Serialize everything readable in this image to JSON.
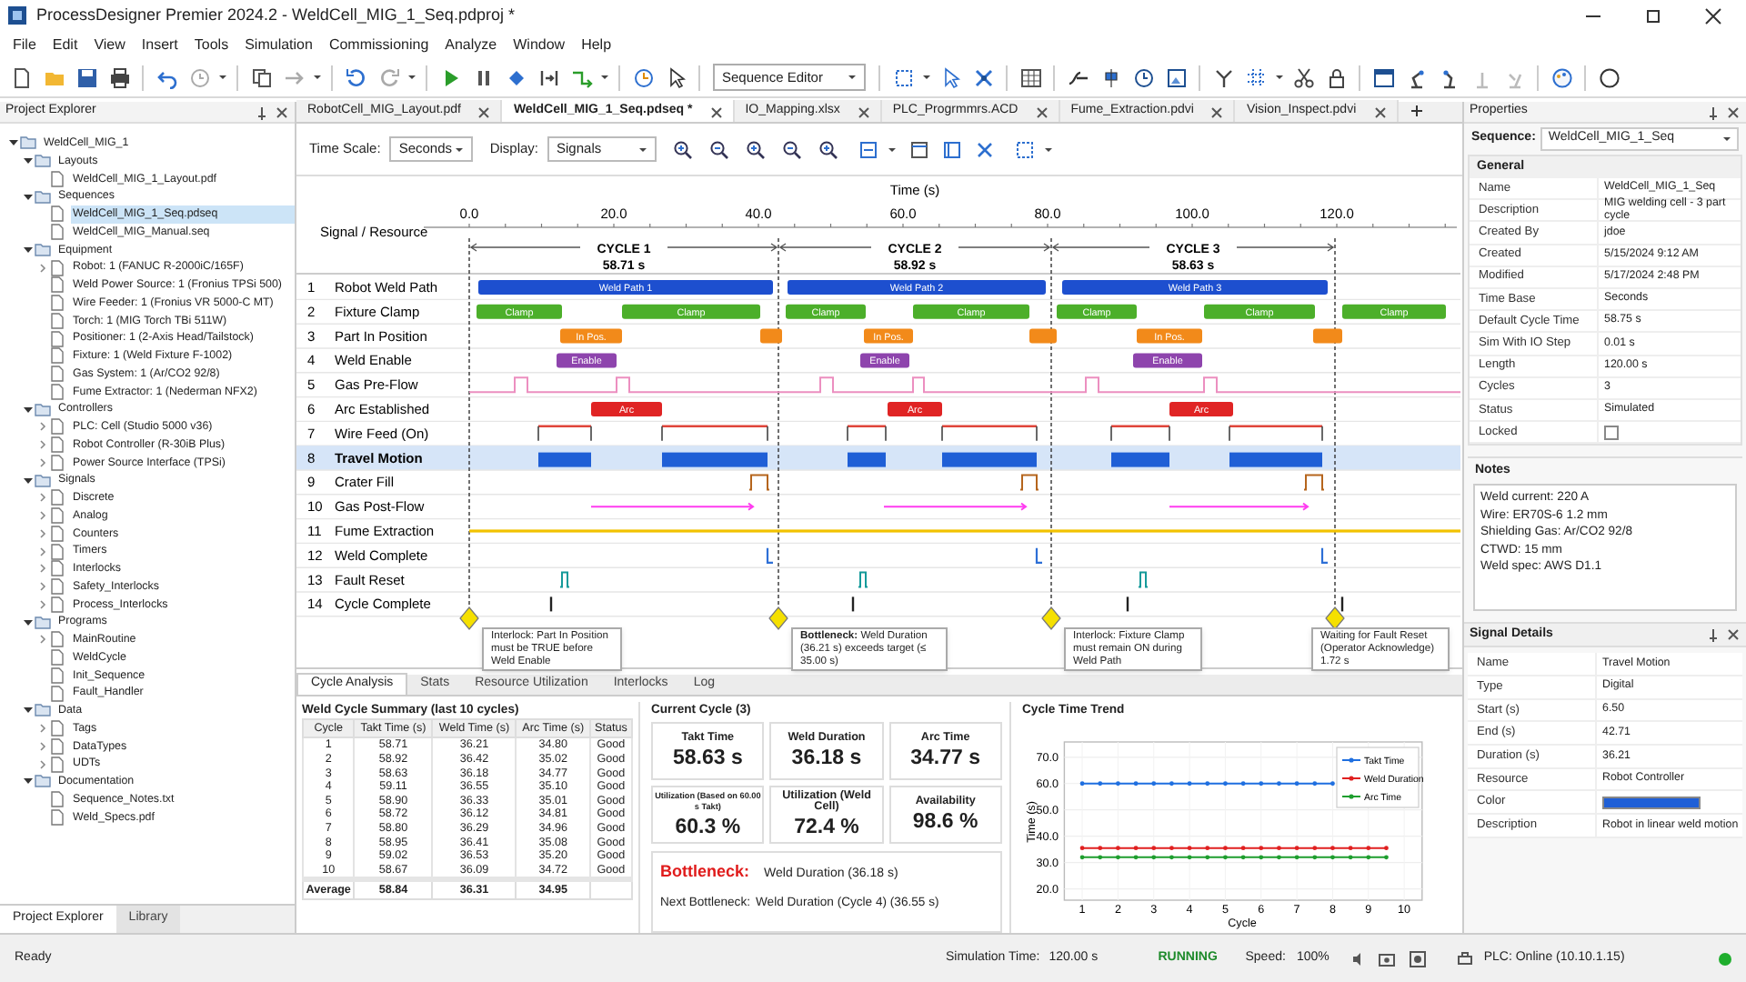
{
  "window": {
    "title": "ProcessDesigner Premier 2024.2 - WeldCell_MIG_1_Seq.pdproj *"
  },
  "menu": [
    "File",
    "Edit",
    "View",
    "Insert",
    "Tools",
    "Simulation",
    "Commissioning",
    "Analyze",
    "Window",
    "Help"
  ],
  "toolbar": {
    "view_select": "Sequence Editor"
  },
  "project_explorer": {
    "title": "Project Explorer",
    "tree": [
      {
        "label": "WeldCell_MIG_1",
        "expanded": true,
        "selected": false,
        "children": [
          {
            "label": "Layouts",
            "expanded": true,
            "selected": false,
            "children": [
              {
                "label": "WeldCell_MIG_1_Layout.pdf",
                "selected": false
              }
            ]
          },
          {
            "label": "Sequences",
            "expanded": true,
            "selected": false,
            "children": [
              {
                "label": "WeldCell_MIG_1_Seq.pdseq",
                "selected": true
              },
              {
                "label": "WeldCell_MIG_Manual.seq",
                "selected": false
              }
            ]
          },
          {
            "label": "Equipment",
            "expanded": true,
            "selected": false,
            "children": [
              {
                "label": "Robot: 1 (FANUC R-2000iC/165F)",
                "expanded": false,
                "selected": false
              },
              {
                "label": "Weld Power Source: 1 (Fronius TPSi 500)",
                "selected": false
              },
              {
                "label": "Wire Feeder: 1 (Fronius VR 5000-C MT)",
                "selected": false
              },
              {
                "label": "Torch: 1 (MIG Torch TBi 511W)",
                "selected": false
              },
              {
                "label": "Positioner: 1 (2-Axis Head/Tailstock)",
                "selected": false
              },
              {
                "label": "Fixture: 1 (Weld Fixture F-1002)",
                "selected": false
              },
              {
                "label": "Gas System: 1 (Ar/CO2 92/8)",
                "selected": false
              },
              {
                "label": "Fume Extractor: 1 (Nederman NFX2)",
                "selected": false
              }
            ]
          },
          {
            "label": "Controllers",
            "expanded": true,
            "selected": false,
            "children": [
              {
                "label": "PLC: Cell (Studio 5000 v36)",
                "expanded": false,
                "selected": false
              },
              {
                "label": "Robot Controller (R-30iB Plus)",
                "expanded": false,
                "selected": false
              },
              {
                "label": "Power Source Interface (TPSi)",
                "expanded": false,
                "selected": false
              }
            ]
          },
          {
            "label": "Signals",
            "expanded": true,
            "selected": false,
            "children": [
              {
                "label": "Discrete",
                "expanded": false,
                "selected": false
              },
              {
                "label": "Analog",
                "expanded": false,
                "selected": false
              },
              {
                "label": "Counters",
                "expanded": false,
                "selected": false
              },
              {
                "label": "Timers",
                "expanded": false,
                "selected": false
              },
              {
                "label": "Interlocks",
                "expanded": false,
                "selected": false
              },
              {
                "label": "Safety_Interlocks",
                "expanded": false,
                "selected": false
              },
              {
                "label": "Process_Interlocks",
                "expanded": false,
                "selected": false
              }
            ]
          },
          {
            "label": "Programs",
            "expanded": true,
            "selected": false,
            "children": [
              {
                "label": "MainRoutine",
                "expanded": false,
                "selected": false
              },
              {
                "label": "WeldCycle",
                "selected": false
              },
              {
                "label": "Init_Sequence",
                "selected": false
              },
              {
                "label": "Fault_Handler",
                "selected": false
              }
            ]
          },
          {
            "label": "Data",
            "expanded": true,
            "selected": false,
            "children": [
              {
                "label": "Tags",
                "expanded": false,
                "selected": false
              },
              {
                "label": "DataTypes",
                "expanded": false,
                "selected": false
              },
              {
                "label": "UDTs",
                "expanded": false,
                "selected": false
              }
            ]
          },
          {
            "label": "Documentation",
            "expanded": true,
            "selected": false,
            "children": [
              {
                "label": "Sequence_Notes.txt",
                "selected": false
              },
              {
                "label": "Weld_Specs.pdf",
                "selected": false
              }
            ]
          }
        ]
      }
    ],
    "tabs": [
      {
        "label": "Project Explorer",
        "selected": true
      },
      {
        "label": "Library",
        "selected": false
      }
    ]
  },
  "document_tabs": [
    {
      "label": "RobotCell_MIG_Layout.pdf",
      "selected": false
    },
    {
      "label": "WeldCell_MIG_1_Seq.pdseq *",
      "selected": true
    },
    {
      "label": "IO_Mapping.xlsx",
      "selected": false
    },
    {
      "label": "PLC_Progrmmrs.ACD",
      "selected": false
    },
    {
      "label": "Fume_Extraction.pdvi",
      "selected": false
    },
    {
      "label": "Vision_Inspect.pdvi",
      "selected": false
    }
  ],
  "editor": {
    "time_scale_label": "Time Scale:",
    "time_scale": "Seconds",
    "display_label": "Display:",
    "display": "Signals"
  },
  "timing_diagram": {
    "axis_title": "Time (s)",
    "ticks": [
      "0.0",
      "20.0",
      "40.0",
      "60.0",
      "80.0",
      "100.0",
      "120.0"
    ],
    "header": "Signal / Resource",
    "cycles": [
      {
        "label": "CYCLE 1",
        "duration": "58.71 s"
      },
      {
        "label": "CYCLE 2",
        "duration": "58.92 s"
      },
      {
        "label": "CYCLE 3",
        "duration": "58.63 s"
      }
    ],
    "signals": [
      {
        "number": "1",
        "name": "Robot Weld Path",
        "selected": false,
        "bar_labels": [
          "Weld Path 1",
          "Weld Path 2",
          "Weld Path 3"
        ]
      },
      {
        "number": "2",
        "name": "Fixture Clamp",
        "selected": false,
        "bar_labels": [
          "Clamp",
          "Clamp",
          "Clamp",
          "Clamp",
          "Clamp",
          "Clamp",
          "Clamp"
        ]
      },
      {
        "number": "3",
        "name": "Part In Position",
        "selected": false,
        "bar_labels": [
          "In Pos.",
          "In Pos.",
          "In Pos."
        ]
      },
      {
        "number": "4",
        "name": "Weld Enable",
        "selected": false,
        "bar_labels": [
          "Enable",
          "Enable",
          "Enable"
        ]
      },
      {
        "number": "5",
        "name": "Gas Pre-Flow",
        "selected": false
      },
      {
        "number": "6",
        "name": "Arc Established",
        "selected": false,
        "bar_labels": [
          "Arc",
          "Arc",
          "Arc"
        ]
      },
      {
        "number": "7",
        "name": "Wire Feed (On)",
        "selected": false
      },
      {
        "number": "8",
        "name": "Travel Motion",
        "selected": true
      },
      {
        "number": "9",
        "name": "Crater Fill",
        "selected": false
      },
      {
        "number": "10",
        "name": "Gas Post-Flow",
        "selected": false
      },
      {
        "number": "11",
        "name": "Fume Extraction",
        "selected": false
      },
      {
        "number": "12",
        "name": "Weld Complete",
        "selected": false
      },
      {
        "number": "13",
        "name": "Fault Reset",
        "selected": false
      },
      {
        "number": "14",
        "name": "Cycle Complete",
        "selected": false
      }
    ],
    "callouts": [
      "Interlock: Part In Position must be TRUE before Weld Enable",
      "**Bottleneck:** Weld Duration (36.21 s) exceeds target (≤ 35.00 s)",
      "Interlock: Fixture Clamp must remain ON during Weld Path",
      "Waiting for Fault Reset (Operator Acknowledge) 1.72 s"
    ]
  },
  "analysis": {
    "tabs": [
      {
        "label": "Cycle Analysis",
        "selected": true
      },
      {
        "label": "Stats",
        "selected": false
      },
      {
        "label": "Resource Utilization",
        "selected": false
      },
      {
        "label": "Interlocks",
        "selected": false
      },
      {
        "label": "Log",
        "selected": false
      }
    ],
    "summary": {
      "title": "Weld Cycle Summary (last 10 cycles)",
      "columns": [
        "Cycle",
        "Takt Time (s)",
        "Weld Time (s)",
        "Arc Time (s)",
        "Status"
      ],
      "rows": [
        [
          "1",
          "58.71",
          "36.21",
          "34.80",
          "Good"
        ],
        [
          "2",
          "58.92",
          "36.42",
          "35.02",
          "Good"
        ],
        [
          "3",
          "58.63",
          "36.18",
          "34.77",
          "Good"
        ],
        [
          "4",
          "59.11",
          "36.55",
          "35.10",
          "Good"
        ],
        [
          "5",
          "58.90",
          "36.33",
          "35.01",
          "Good"
        ],
        [
          "6",
          "58.72",
          "36.12",
          "34.81",
          "Good"
        ],
        [
          "7",
          "58.80",
          "36.29",
          "34.96",
          "Good"
        ],
        [
          "8",
          "58.95",
          "36.41",
          "35.08",
          "Good"
        ],
        [
          "9",
          "59.02",
          "36.53",
          "35.20",
          "Good"
        ],
        [
          "10",
          "58.67",
          "36.09",
          "34.72",
          "Good"
        ]
      ],
      "average": {
        "label": "Average",
        "values": [
          "58.84",
          "36.31",
          "34.95"
        ]
      }
    },
    "current_cycle": {
      "title": "Current Cycle (3)",
      "cards": [
        {
          "label": "Takt Time",
          "value": "58.63 s"
        },
        {
          "label": "Weld Duration",
          "value": "36.18 s"
        },
        {
          "label": "Arc Time",
          "value": "34.77 s"
        },
        {
          "label": "Utilization (Based on 60.00 s Takt)",
          "value": "60.3 %"
        },
        {
          "label": "Utilization (Weld Cell)",
          "value": "72.4 %"
        },
        {
          "label": "Availability",
          "value": "98.6 %"
        }
      ],
      "bottleneck": {
        "label": "Bottleneck:",
        "value": "Weld Duration (36.18 s)"
      },
      "next_bottleneck": {
        "label": "Next Bottleneck:",
        "value": "Weld Duration (Cycle 4) (36.55 s)"
      }
    },
    "trend": {
      "chart_data": {
        "type": "line",
        "title": "Cycle Time Trend",
        "xlabel": "Cycle",
        "ylabel": "Time (s)",
        "x": [
          1,
          1.5,
          2,
          2.5,
          3,
          3.5,
          4,
          4.5,
          5,
          5.5,
          6,
          6.5,
          7,
          7.5,
          8,
          8.5,
          9,
          9.5
        ],
        "series": [
          {
            "name": "Takt Time",
            "color": "#1f6fe0",
            "values": [
              60,
              60,
              60,
              60,
              60,
              60,
              60,
              60,
              60,
              60,
              60,
              60,
              60,
              60,
              60,
              null,
              null,
              null
            ]
          },
          {
            "name": "Weld Duration",
            "color": "#e02020",
            "values": [
              35.5,
              35.5,
              35.5,
              35.5,
              35.5,
              35.5,
              35.5,
              35.5,
              35.5,
              35.5,
              35.5,
              35.5,
              35.5,
              35.5,
              35.5,
              35.5,
              35.5,
              35.5
            ]
          },
          {
            "name": "Arc Time",
            "color": "#1e9e2e",
            "values": [
              32,
              32,
              32,
              32,
              32,
              32,
              32,
              32,
              32,
              32,
              32,
              32,
              32,
              32,
              32,
              32,
              32,
              32
            ]
          }
        ],
        "grid": true,
        "legend": true,
        "xlim": [
          0.5,
          10.5
        ],
        "ylim": [
          15.7,
          75.8
        ],
        "xticks": [
          1,
          2,
          3,
          4,
          5,
          6,
          7,
          8,
          9,
          10
        ],
        "yticks": [
          {
            "value": 20,
            "label": "20.0"
          },
          {
            "value": 30,
            "label": "30.0"
          },
          {
            "value": 40,
            "label": "40.0"
          },
          {
            "value": 50,
            "label": "50.0"
          },
          {
            "value": 60,
            "label": "60.0"
          },
          {
            "value": 70,
            "label": "70.0"
          }
        ]
      }
    }
  },
  "properties": {
    "title": "Properties",
    "sequence_label": "Sequence:",
    "sequence": "WeldCell_MIG_1_Seq",
    "section": "General",
    "rows": [
      {
        "name": "Name",
        "kind": "text",
        "value": "WeldCell_MIG_1_Seq"
      },
      {
        "name": "Description",
        "kind": "text",
        "value": "MIG welding cell - 3 part cycle"
      },
      {
        "name": "Created By",
        "kind": "text",
        "value": "jdoe"
      },
      {
        "name": "Created",
        "kind": "text",
        "value": "5/15/2024 9:12 AM"
      },
      {
        "name": "Modified",
        "kind": "text",
        "value": "5/17/2024 2:48 PM"
      },
      {
        "name": "Time Base",
        "kind": "text",
        "value": "Seconds"
      },
      {
        "name": "Default Cycle Time",
        "kind": "text",
        "value": "58.75 s"
      },
      {
        "name": "Sim With IO Step",
        "kind": "text",
        "value": "0.01 s"
      },
      {
        "name": "Length",
        "kind": "text",
        "value": "120.00 s"
      },
      {
        "name": "Cycles",
        "kind": "text",
        "value": "3"
      },
      {
        "name": "Status",
        "kind": "text",
        "value": "Simulated"
      },
      {
        "name": "Locked",
        "kind": "checkbox",
        "checked": false
      }
    ],
    "notes_title": "Notes",
    "notes": [
      "Weld current: 220 A",
      "Wire: ER70S-6 1.2 mm",
      "Shielding Gas: Ar/CO2 92/8",
      "CTWD: 15 mm",
      "Weld spec: AWS D1.1"
    ]
  },
  "signal_details": {
    "title": "Signal Details",
    "rows": [
      {
        "name": "Name",
        "kind": "text",
        "value": "Travel Motion"
      },
      {
        "name": "Type",
        "kind": "text",
        "value": "Digital"
      },
      {
        "name": "Start (s)",
        "kind": "text",
        "value": "6.50"
      },
      {
        "name": "End (s)",
        "kind": "text",
        "value": "42.71"
      },
      {
        "name": "Duration (s)",
        "kind": "text",
        "value": "36.21"
      },
      {
        "name": "Resource",
        "kind": "text",
        "value": "Robot Controller"
      },
      {
        "name": "Color",
        "kind": "color",
        "color": "#1f5fd6"
      },
      {
        "name": "Description",
        "kind": "text",
        "value": "Robot in linear weld motion"
      }
    ]
  },
  "status_bar": {
    "message": "Ready",
    "sim_time_label": "Simulation Time:",
    "sim_time": "120.00 s",
    "state": "RUNNING",
    "speed_label": "Speed:",
    "speed": "100%",
    "plc": "PLC: Online (10.10.1.15)",
    "plc_online": true
  }
}
